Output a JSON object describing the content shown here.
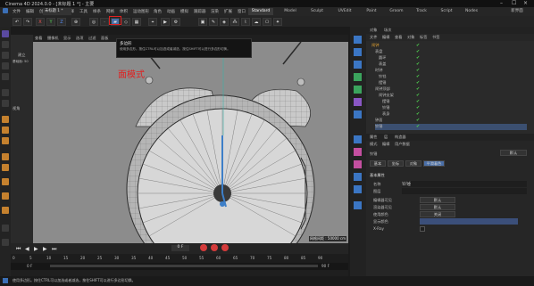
{
  "app": {
    "title": "Cinema 4D 2024.0.0 - [未标题 1 *] - 主要",
    "doc_tab": "未标题 1 *"
  },
  "menu": [
    "文件",
    "编辑",
    "创建",
    "模式",
    "选择",
    "工具",
    "样条",
    "网格",
    "体积",
    "运动图形",
    "角色",
    "动画",
    "模拟",
    "跟踪器",
    "渲染",
    "扩展",
    "窗口",
    "帮助"
  ],
  "workspaces": [
    "Standard",
    "Model",
    "Sculpt",
    "UVEdit",
    "Paint",
    "Groom",
    "Track",
    "Script",
    "Nodes"
  ],
  "workspace_active": "Standard",
  "layout_label": "新界面",
  "mode_tooltip": {
    "title": "多边形",
    "text": "使用多边形。按住CTRL可以加选或者减选，按住SHIFT可以进行多边形切换。"
  },
  "annotation": "面模式",
  "viewport": {
    "header_items": [
      "查看",
      "摄像机",
      "显示",
      "选项",
      "过滤",
      "面板"
    ],
    "grid_spacing": "网格间距 : 50000 cm",
    "axis_label": "Y"
  },
  "left_attr": {
    "label1": "建立",
    "label2": "基础面: 50",
    "label3": "视角"
  },
  "object_panel": {
    "tabs": [
      "对象",
      "场次"
    ],
    "menu": [
      "文件",
      "编辑",
      "查看",
      "对象",
      "标签",
      "书签"
    ],
    "items": [
      "闹钟",
      "表盘",
      "圆环",
      "表盖",
      "时钟",
      "铃铛",
      "摆锤",
      "闹钟顶部",
      "闹钟支架",
      "摆锤",
      "铃锤",
      "表身",
      "钟面",
      "铃锤"
    ]
  },
  "attr_panel": {
    "tabs": [
      "属性",
      "层",
      "构造器"
    ],
    "menu": [
      "模式",
      "编辑",
      "用户数据"
    ],
    "object_name": "铃锤",
    "subtabs": [
      "基本",
      "坐标",
      "对象",
      "平滑着色"
    ],
    "section": "基本属性",
    "fields": [
      "名称",
      "图层",
      "编辑器可见",
      "渲染器可见",
      "使用颜色",
      "显示颜色",
      "X-Ray"
    ],
    "values": [
      "铃锤",
      "",
      "默认",
      "默认",
      "关闭",
      "",
      ""
    ]
  },
  "timeline": {
    "frame_start": "0 F",
    "frame_current": "0 F",
    "frame_end": "90 F",
    "ruler": [
      "0",
      "5",
      "10",
      "15",
      "20",
      "25",
      "30",
      "35",
      "40",
      "45",
      "50",
      "55",
      "60",
      "65",
      "70",
      "75",
      "80",
      "85",
      "90"
    ]
  },
  "status": "使用多边形。按住CTRL可以加选或者减选，按住SHIFT可以进行多边形切换。"
}
